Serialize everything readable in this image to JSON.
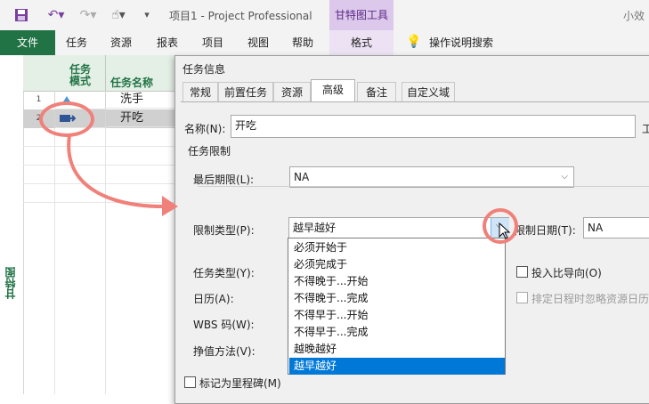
{
  "titlebar": {
    "doc_title": "项目1  -  Project Professional",
    "context_tab": "甘特图工具",
    "user": "小效"
  },
  "ribbon": {
    "tabs": [
      "文件",
      "任务",
      "资源",
      "报表",
      "项目",
      "视图",
      "帮助",
      "格式"
    ],
    "search": "操作说明搜索"
  },
  "view_label": "甘特图",
  "sheet": {
    "col_mode": "任务\n模式",
    "col_name": "任务名称",
    "rows": [
      {
        "num": "1",
        "name": "洗手"
      },
      {
        "num": "2",
        "name": "开吃"
      }
    ]
  },
  "dialog": {
    "title": "任务信息",
    "tabs": [
      "常规",
      "前置任务",
      "资源",
      "高级",
      "备注",
      "自定义域"
    ],
    "active_tab": "高级",
    "name_label": "名称(N):",
    "name_value": "开吃",
    "name_suffix": "工",
    "constraint_section": "任务限制",
    "deadline_label": "最后期限(L):",
    "deadline_value": "NA",
    "constraint_type_label": "限制类型(P):",
    "constraint_type_value": "越早越好",
    "constraint_date_label": "限制日期(T):",
    "constraint_date_value": "NA",
    "task_type_label": "任务类型(Y):",
    "calendar_label": "日历(A):",
    "wbs_label": "WBS 码(W):",
    "earned_value_label": "挣值方法(V):",
    "effort_driven": "投入比导向(O)",
    "ignore_resource_cal": "排定日程时忽略资源日历",
    "milestone": "标记为里程碑(M)"
  },
  "constraint_options": [
    "必须开始于",
    "必须完成于",
    "不得晚于...开始",
    "不得晚于...完成",
    "不得早于...开始",
    "不得早于...完成",
    "越晚越好",
    "越早越好"
  ],
  "colors": {
    "file_tab": "#217346",
    "selection": "#0078d7",
    "annotation": "#f0817a",
    "context_tab": "#dcc8ea"
  }
}
